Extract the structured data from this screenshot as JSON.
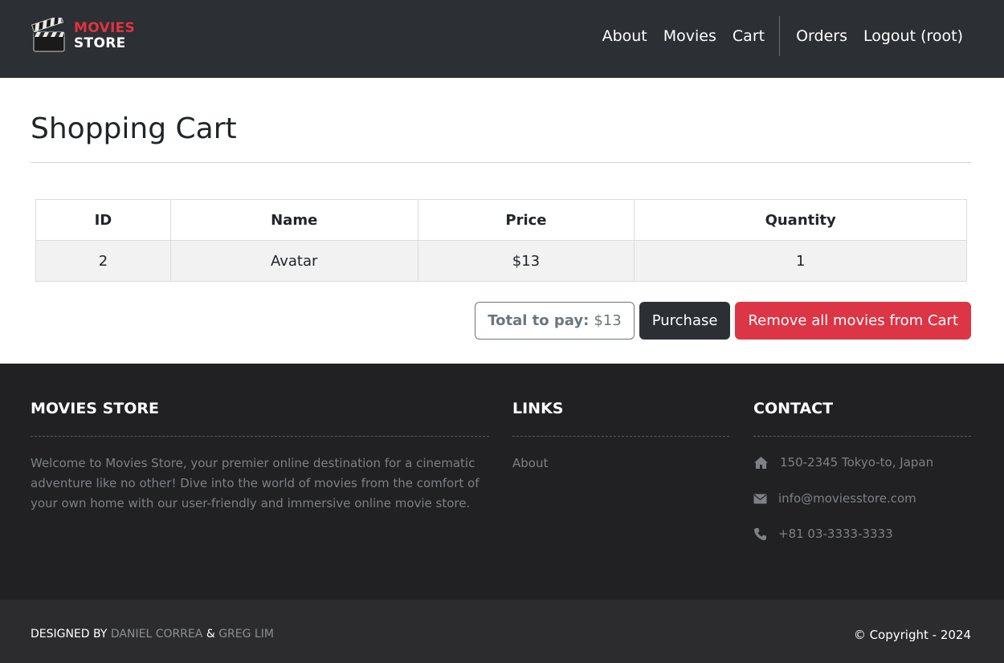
{
  "nav": {
    "brand_top": "MOVIES",
    "brand_bottom": "STORE",
    "links": [
      "About",
      "Movies",
      "Cart"
    ],
    "user_links": [
      "Orders",
      "Logout (root)"
    ]
  },
  "page": {
    "title": "Shopping Cart"
  },
  "cart": {
    "headers": [
      "ID",
      "Name",
      "Price",
      "Quantity"
    ],
    "rows": [
      {
        "id": "2",
        "name": "Avatar",
        "price": "$13",
        "quantity": "1"
      }
    ],
    "total_label": "Total to pay:",
    "total_value": "$13",
    "purchase_label": "Purchase",
    "remove_label": "Remove all movies from Cart"
  },
  "footer": {
    "about_title": "MOVIES STORE",
    "about_text": "Welcome to Movies Store, your premier online destination for a cinematic adventure like no other! Dive into the world of movies from the comfort of your own home with our user-friendly and immersive online movie store.",
    "links_title": "LINKS",
    "links": [
      "About"
    ],
    "contact_title": "CONTACT",
    "address": "150-2345 Tokyo-to, Japan",
    "email": "info@moviesstore.com",
    "phone": "+81 03-3333-3333",
    "designed_by": "DESIGNED BY",
    "designer_1": "DANIEL CORREA",
    "amp": "&",
    "designer_2": "GREG LIM",
    "copyright": "© Copyright - 2024"
  },
  "colors": {
    "navbar": "#2c2f33",
    "brand_red": "#e03340",
    "danger": "#dc3545",
    "footer": "#212124"
  }
}
